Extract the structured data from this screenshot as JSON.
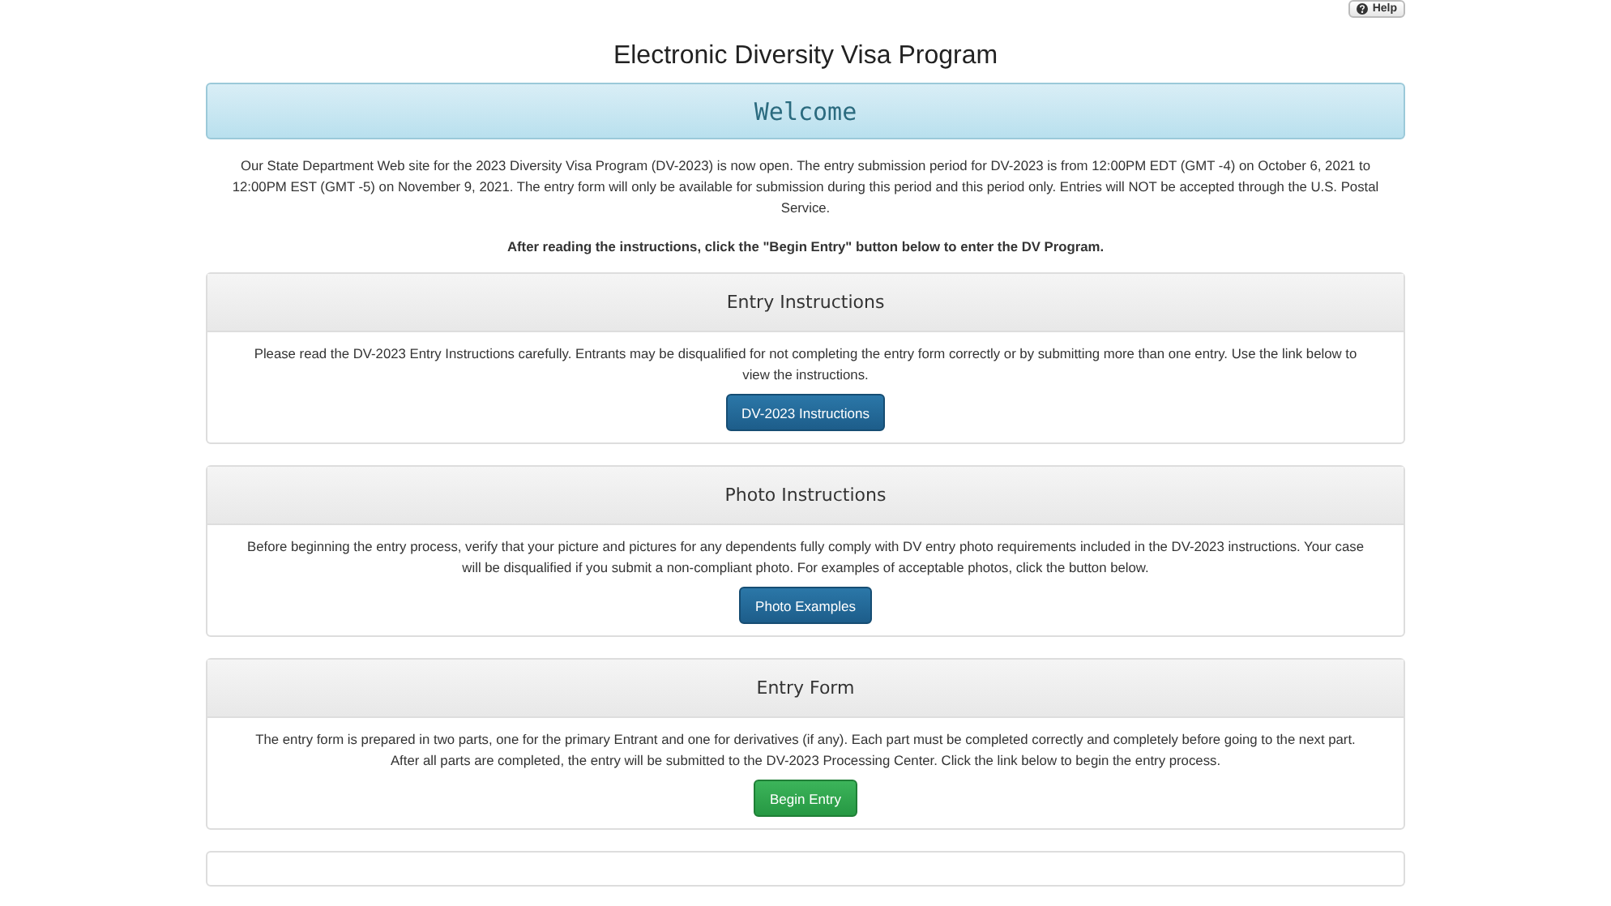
{
  "help_button": {
    "label": "Help"
  },
  "title": "Electronic Diversity Visa Program",
  "banner": "Welcome",
  "intro": "Our State Department Web site for the 2023 Diversity Visa Program (DV-2023) is now open. The entry submission period for DV-2023 is from 12:00PM EDT (GMT -4) on October 6, 2021 to 12:00PM EST (GMT -5) on November 9, 2021. The entry form will only be available for submission during this period and this period only. Entries will NOT be accepted through the U.S. Postal Service.",
  "instruction": "After reading the instructions, click the \"Begin Entry\" button below to enter the DV Program.",
  "panels": [
    {
      "heading": "Entry Instructions",
      "text": "Please read the DV-2023 Entry Instructions carefully. Entrants may be disqualified for not completing the entry form correctly or by submitting more than one entry. Use the link below to view the instructions.",
      "button": {
        "label": "DV-2023 Instructions",
        "kind": "primary"
      }
    },
    {
      "heading": "Photo Instructions",
      "text": "Before beginning the entry process, verify that your picture and pictures for any dependents fully comply with DV entry photo requirements included in the DV-2023 instructions.  Your case will be disqualified if you submit a non-compliant photo.  For examples of acceptable photos, click the button below.",
      "button": {
        "label": "Photo Examples",
        "kind": "primary"
      }
    },
    {
      "heading": "Entry Form",
      "text": "The entry form is prepared in two parts, one for the primary Entrant and one for derivatives (if any). Each part must be completed correctly and completely before going to the next part. After all parts are completed, the entry will be submitted to the DV-2023 Processing Center. Click the link below to begin the entry process.",
      "button": {
        "label": "Begin Entry",
        "kind": "success"
      }
    }
  ]
}
